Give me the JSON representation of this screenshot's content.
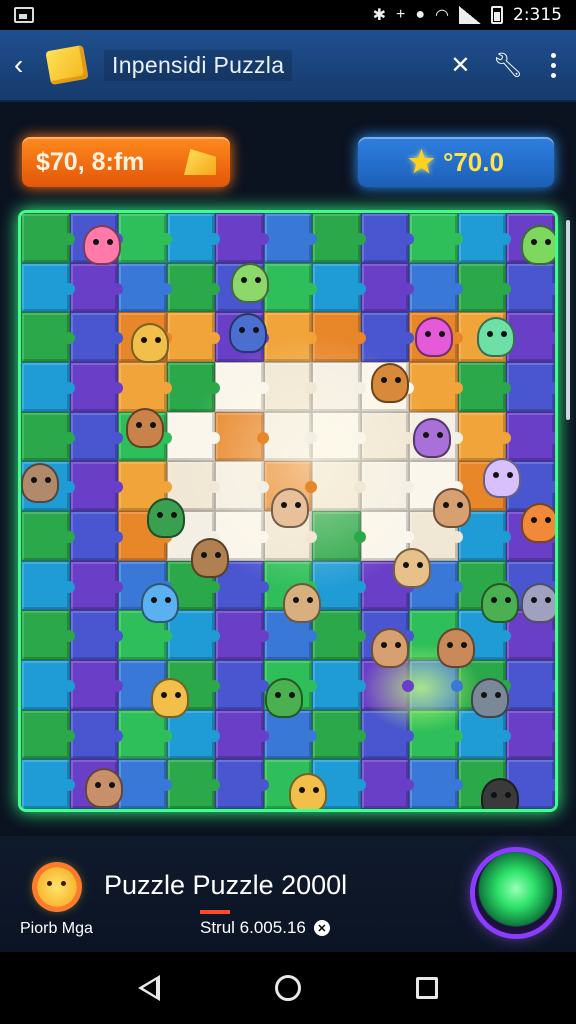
{
  "status_bar": {
    "time": "2:315"
  },
  "app_bar": {
    "title": "Inpensidi Puzzla"
  },
  "hud": {
    "coins": "$70, 8:fm",
    "stars": "°70.0"
  },
  "game": {
    "title": "Puzzle Puzzle 2000l",
    "player_label": "Piorb Mga",
    "stat": "Strul 6.005.16"
  },
  "colors": {
    "board_border": "#3dff8a",
    "coin_pill": "#ff8a1e",
    "star_pill": "#2e7fe0",
    "action_ring": "#8b3dff"
  }
}
